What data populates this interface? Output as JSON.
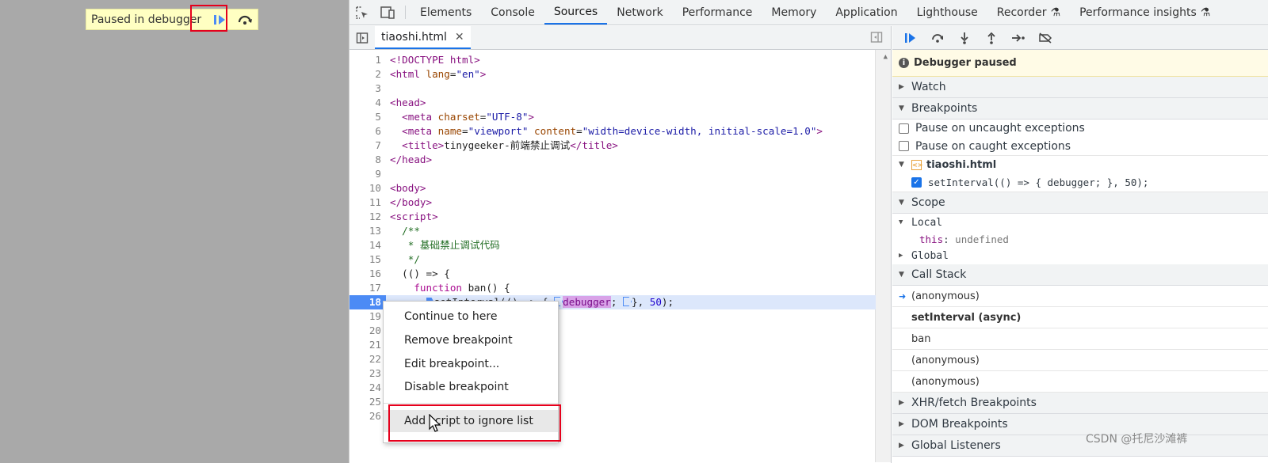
{
  "page": {
    "paused_label": "Paused in debugger"
  },
  "devtools": {
    "tabs": [
      "Elements",
      "Console",
      "Sources",
      "Network",
      "Performance",
      "Memory",
      "Application",
      "Lighthouse",
      "Recorder",
      "Performance insights"
    ],
    "active_tab": "Sources"
  },
  "editor": {
    "file_tab": "tiaoshi.html",
    "execution_line": "18",
    "lines": [
      "1",
      "2",
      "3",
      "4",
      "5",
      "6",
      "7",
      "8",
      "9",
      "10",
      "11",
      "12",
      "13",
      "14",
      "15",
      "16",
      "17",
      "18",
      "19",
      "20",
      "21",
      "22",
      "23",
      "24",
      "25",
      "26"
    ],
    "code": {
      "l1": "<!DOCTYPE html>",
      "l2_tag": "<html ",
      "l2_attr": "lang",
      "l2_val": "\"en\"",
      "l2_end": ">",
      "l4": "<head>",
      "l5_a": "  <meta ",
      "l5_b": "charset",
      "l5_c": "\"UTF-8\"",
      "l5_d": ">",
      "l6_a": "  <meta ",
      "l6_b": "name",
      "l6_c": "\"viewport\"",
      "l6_d": "content",
      "l6_e": "\"width=device-width, initial-scale=1.0\"",
      "l6_f": ">",
      "l7_a": "  <title>",
      "l7_b": "tinygeeker-前端禁止调试",
      "l7_c": "</title>",
      "l8": "</head>",
      "l10": "<body>",
      "l11": "</body>",
      "l12": "<script>",
      "l13": "  /**",
      "l14": "   * 基础禁止调试代码",
      "l15": "   */",
      "l16": "  (() => {",
      "l17_a": "    function",
      "l17_b": " ban() {",
      "l18_a": "      ",
      "l18_b": "setInterval(() => { ",
      "l18_c": "debugger",
      "l18_d": "; ",
      "l18_e": "}, ",
      "l18_f": "50",
      "l18_g": ");"
    }
  },
  "context_menu": {
    "items": [
      "Continue to here",
      "Remove breakpoint",
      "Edit breakpoint...",
      "Disable breakpoint",
      "Add script to ignore list"
    ]
  },
  "sidebar": {
    "paused_message": "Debugger paused",
    "watch": "Watch",
    "breakpoints": "Breakpoints",
    "pause_uncaught": "Pause on uncaught exceptions",
    "pause_caught": "Pause on caught exceptions",
    "bp_file": "tiaoshi.html",
    "bp_code": "setInterval(() => { debugger; }, 50);",
    "scope": "Scope",
    "local": "Local",
    "this_key": "this",
    "this_val": "undefined",
    "global": "Global",
    "call_stack": "Call Stack",
    "stack": [
      "(anonymous)",
      "setInterval (async)",
      "ban",
      "(anonymous)",
      "(anonymous)"
    ],
    "xhr_bps": "XHR/fetch Breakpoints",
    "dom_bps": "DOM Breakpoints",
    "global_listeners": "Global Listeners"
  },
  "watermark": "CSDN @托尼沙滩裤",
  "colors": {
    "accent": "#1a73e8",
    "highlight_box": "#e5001c",
    "paused_bg": "#ffffc2"
  }
}
